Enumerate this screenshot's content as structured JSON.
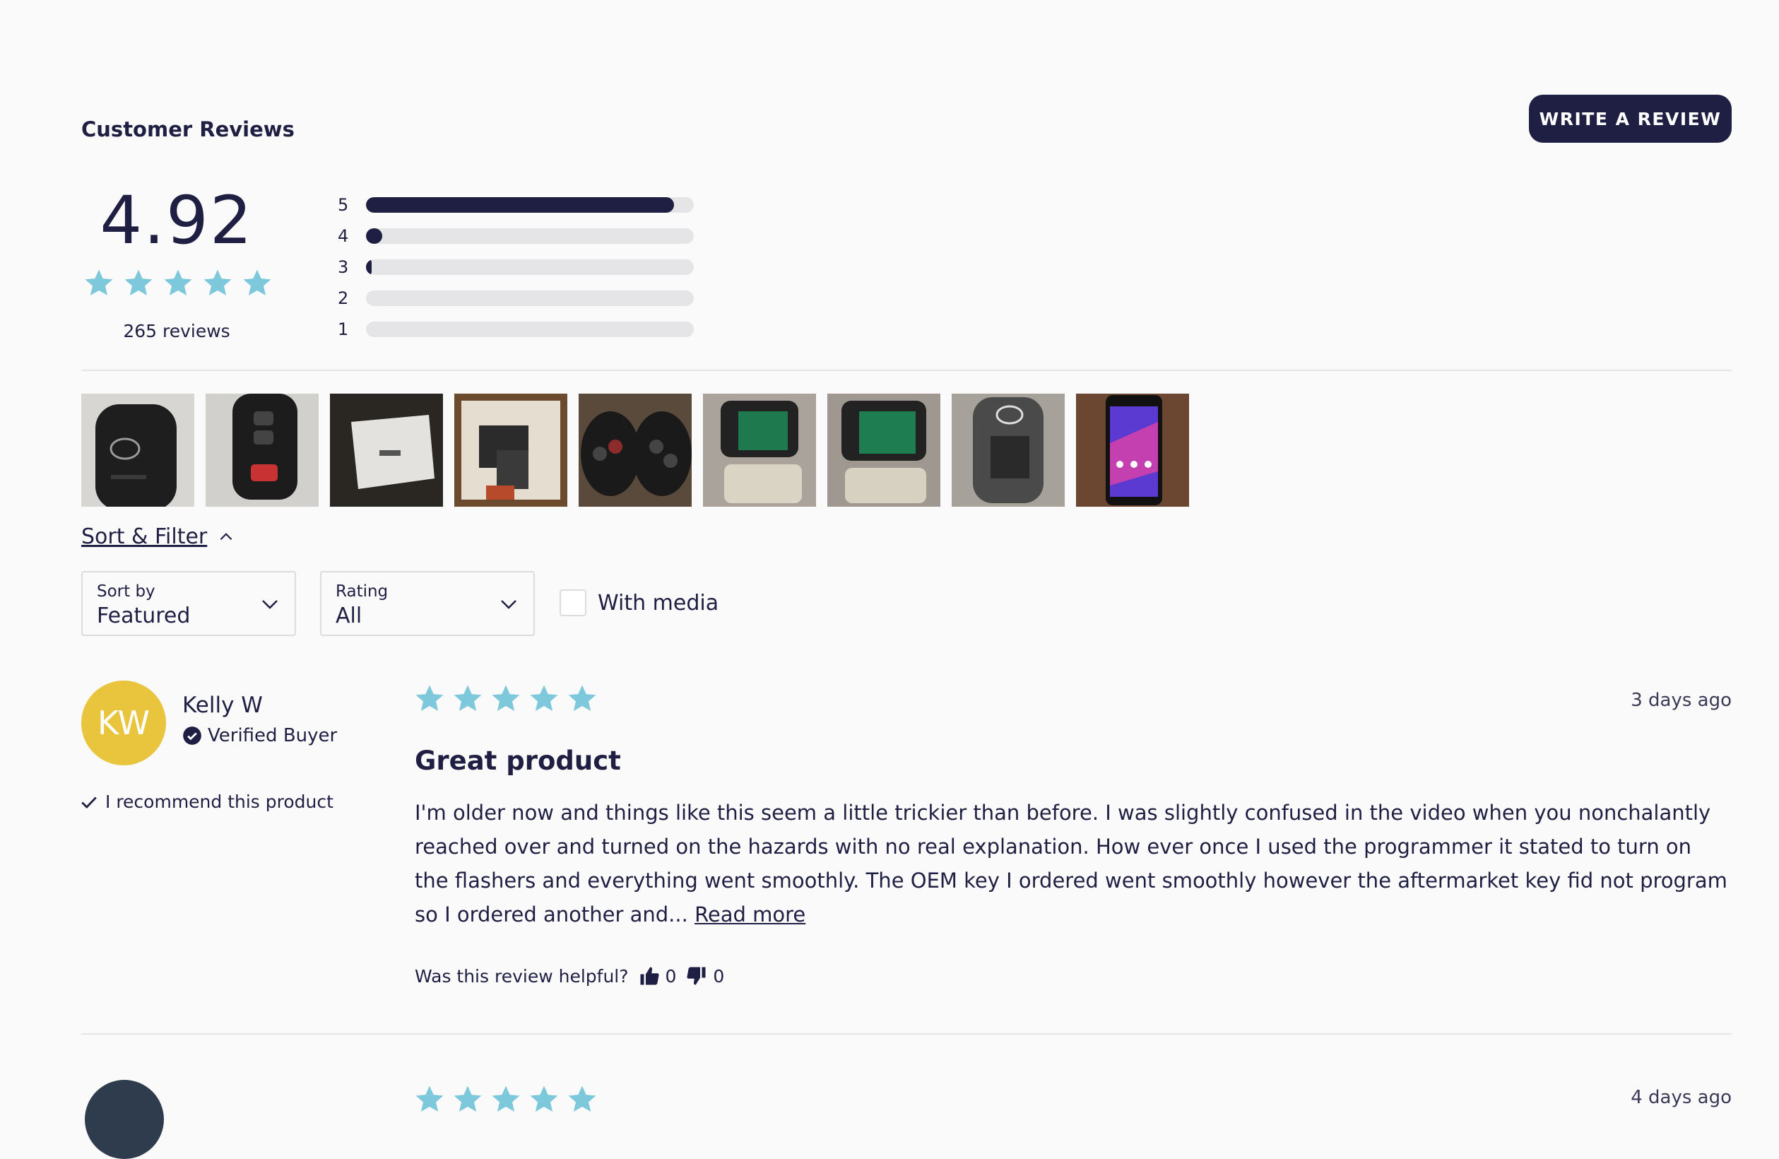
{
  "header": {
    "title": "Customer Reviews",
    "write_button": "WRITE A REVIEW"
  },
  "summary": {
    "average": "4.92",
    "average_stars": 5,
    "total_label": "265 reviews",
    "distribution": [
      {
        "stars": "5",
        "fraction": 0.94
      },
      {
        "stars": "4",
        "fraction": 0.05
      },
      {
        "stars": "3",
        "fraction": 0.01
      },
      {
        "stars": "2",
        "fraction": 0.0
      },
      {
        "stars": "1",
        "fraction": 0.0
      }
    ]
  },
  "media_thumbnails": [
    {
      "name": "black-smart-key-fob-photo"
    },
    {
      "name": "smart-key-red-button-photo"
    },
    {
      "name": "white-box-photo"
    },
    {
      "name": "boxed-keys-photo"
    },
    {
      "name": "two-remote-keys-photo"
    },
    {
      "name": "open-fob-circuit-board-photo"
    },
    {
      "name": "circuit-board-closeup-photo"
    },
    {
      "name": "fob-case-back-photo"
    },
    {
      "name": "phone-screen-photo"
    }
  ],
  "filters": {
    "toggle_label": "Sort & Filter",
    "sort_label": "Sort by",
    "sort_value": "Featured",
    "rating_label": "Rating",
    "rating_value": "All",
    "media_label": "With media",
    "media_checked": false
  },
  "review": {
    "initials": "KW",
    "author": "Kelly W",
    "verified_label": "Verified Buyer",
    "recommend_label": "I recommend this product",
    "stars": 5,
    "date": "3 days ago",
    "title": "Great product",
    "body": "I'm older now and things like this seem a little trickier than before.  I was slightly confused in the video when you nonchalantly reached over and turned on the hazards with no real explanation. How ever once I used the programmer it stated to turn on the flashers and everything went smoothly. The OEM key I ordered went smoothly however the aftermarket key fid not program so I ordered another and...",
    "read_more": "Read more",
    "helpful_label": "Was this review helpful?",
    "helpful_yes": "0",
    "helpful_no": "0"
  },
  "next_review": {
    "stars": 5,
    "date": "4 days ago"
  },
  "colors": {
    "navy": "#1f1f44",
    "star": "#7ec8dc",
    "avatar_yellow": "#e8c53d",
    "track": "#e5e5e7"
  }
}
